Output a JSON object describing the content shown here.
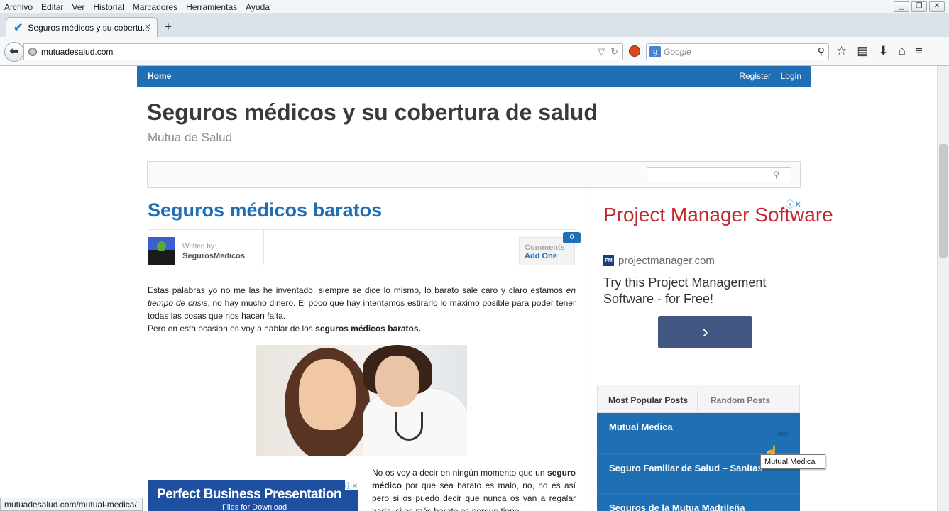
{
  "menubar": [
    "Archivo",
    "Editar",
    "Ver",
    "Historial",
    "Marcadores",
    "Herramientas",
    "Ayuda"
  ],
  "tab": {
    "title": "Seguros médicos y su cobertu...",
    "close": "✕",
    "new": "+"
  },
  "urlbar": {
    "url": "mutuadesalud.com"
  },
  "search": {
    "placeholder": "Google"
  },
  "site": {
    "nav": {
      "home": "Home",
      "register": "Register",
      "login": "Login"
    },
    "title": "Seguros médicos y su cobertura de salud",
    "subtitle": "Mutua de Salud"
  },
  "post": {
    "title": "Seguros médicos baratos",
    "written_by": "Written by:",
    "author": "SegurosMedicos",
    "comments_label": "Comments",
    "add_one": "Add One",
    "comment_count": "0",
    "p1_a": "Estas palabras yo no me las he inventado, siempre se dice lo mismo, lo barato sale caro y claro estamos ",
    "p1_em": "en tiempo de crisis",
    "p1_b": ", no hay mucho dinero. El poco que hay intentamos estirarlo lo máximo posible para poder tener todas las cosas que nos hacen falta.",
    "p2_a": "Pero en esta ocasión os voy a hablar de los ",
    "p2_b": "seguros médicos baratos.",
    "p3_a": "No os voy a decir en ningún momento que un ",
    "p3_b": "seguro médico",
    "p3_c": " por que sea barato es malo, no, no es así pero si os puedo decir que nunca os van a regalar nada, si es más barato es porque tiene"
  },
  "ad_left": {
    "title": "Perfect Business Presentation",
    "sub": "Files for Download"
  },
  "ad_right": {
    "title": "Project Manager Software",
    "domain": "projectmanager.com",
    "badge": "PM",
    "desc": "Try this Project Management Software - for Free!",
    "button": "›"
  },
  "sidebar": {
    "tab_popular": "Most Popular Posts",
    "tab_random": "Random Posts",
    "posts": [
      "Mutual Medica",
      "Seguro Familiar de Salud – Sanitas",
      "Seguros de la Mutua Madrileña"
    ]
  },
  "tooltip": "Mutual Medica",
  "status": "mutuadesalud.com/mutual-medica/"
}
